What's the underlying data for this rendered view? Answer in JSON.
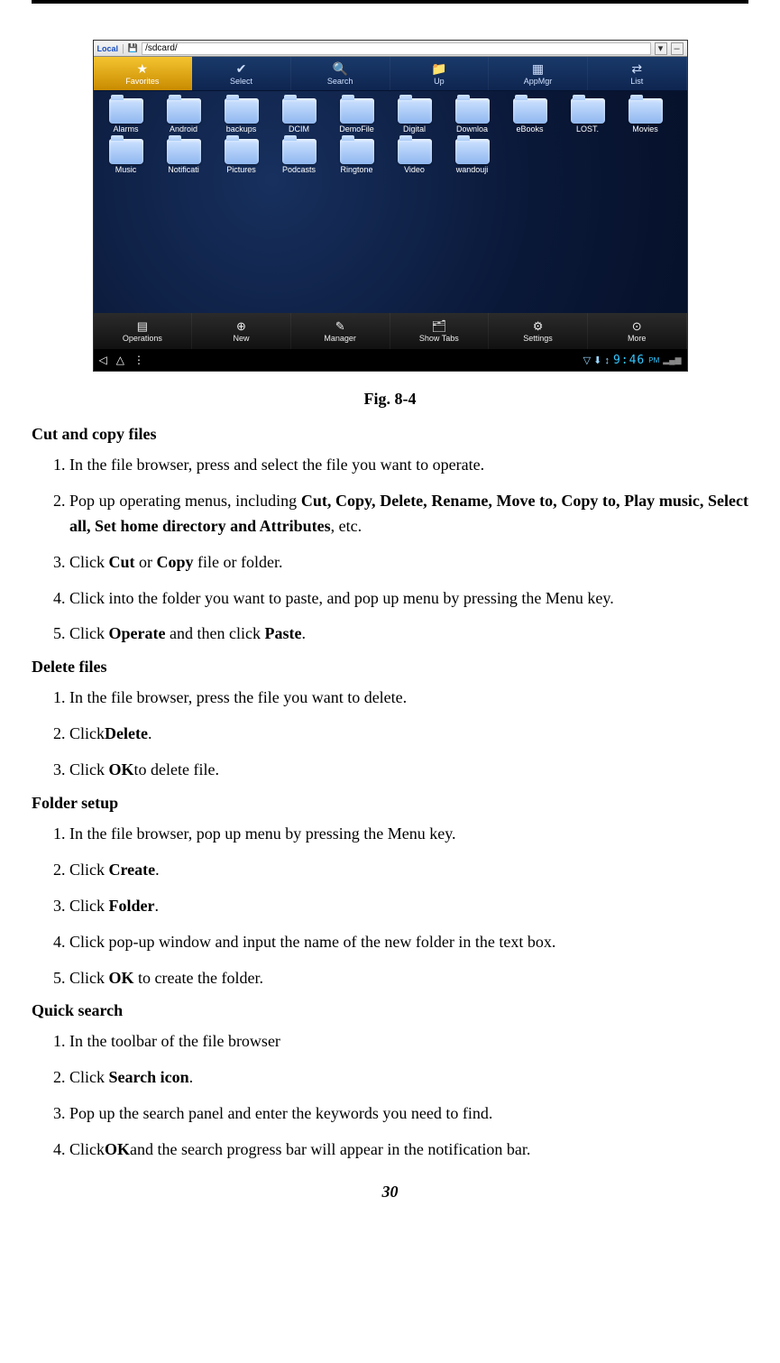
{
  "address_bar": {
    "local_label": "Local",
    "path": "/sdcard/"
  },
  "top_toolbar": [
    {
      "icon": "★",
      "label": "Favorites"
    },
    {
      "icon": "✔",
      "label": "Select"
    },
    {
      "icon": "🔍",
      "label": "Search"
    },
    {
      "icon": "📁",
      "label": "Up"
    },
    {
      "icon": "▦",
      "label": "AppMgr"
    },
    {
      "icon": "⇄",
      "label": "List"
    }
  ],
  "folders_row1": [
    "Alarms",
    "Android",
    "backups",
    "DCIM",
    "DemoFile",
    "Digital",
    "Downloa",
    "eBooks",
    "LOST.",
    "Movies"
  ],
  "folders_row2": [
    "Music",
    "Notificati",
    "Pictures",
    "Podcasts",
    "Ringtone",
    "Video",
    "wandouji"
  ],
  "bottom_toolbar": [
    {
      "icon": "▤",
      "label": "Operations"
    },
    {
      "icon": "⊕",
      "label": "New"
    },
    {
      "icon": "✎",
      "label": "Manager"
    },
    {
      "icon": "🗂",
      "label": "Show Tabs"
    },
    {
      "icon": "⚙",
      "label": "Settings"
    },
    {
      "icon": "⊙",
      "label": "More"
    }
  ],
  "sysbar": {
    "nav": [
      "◁",
      "△",
      "⋮"
    ],
    "status": [
      "▽",
      "⬇",
      "↕"
    ],
    "time": "9:46",
    "ampm": "PM",
    "signal": "▂▄▆"
  },
  "caption": "Fig. 8-4",
  "sections": {
    "cutcopy": {
      "title": "Cut and copy files",
      "items": [
        [
          {
            "t": "In the file browser, press and select the file you want to operate."
          }
        ],
        [
          {
            "t": "Pop up operating menus, including "
          },
          {
            "t": "Cut, Copy, Delete, Rename, Move to, Copy to, Play music, Select all, Set home directory and Attributes",
            "b": true
          },
          {
            "t": ", etc."
          }
        ],
        [
          {
            "t": "Click "
          },
          {
            "t": "Cut",
            "b": true
          },
          {
            "t": " or "
          },
          {
            "t": "Copy",
            "b": true
          },
          {
            "t": " file or folder."
          }
        ],
        [
          {
            "t": "Click into the folder you want to paste, and pop up menu by pressing the Menu key."
          }
        ],
        [
          {
            "t": "Click "
          },
          {
            "t": "Operate",
            "b": true
          },
          {
            "t": " and then click "
          },
          {
            "t": "Paste",
            "b": true
          },
          {
            "t": "."
          }
        ]
      ]
    },
    "delete": {
      "title": "Delete files",
      "items": [
        [
          {
            "t": "In the file browser, press the file you want to delete."
          }
        ],
        [
          {
            "t": "Click"
          },
          {
            "t": "Delete",
            "b": true
          },
          {
            "t": "."
          }
        ],
        [
          {
            "t": "Click "
          },
          {
            "t": "OK",
            "b": true
          },
          {
            "t": "to delete file."
          }
        ]
      ]
    },
    "foldersetup": {
      "title": "Folder setup",
      "items": [
        [
          {
            "t": "In the file browser, pop up menu by pressing the Menu key."
          }
        ],
        [
          {
            "t": "Click "
          },
          {
            "t": "Create",
            "b": true
          },
          {
            "t": "."
          }
        ],
        [
          {
            "t": "Click "
          },
          {
            "t": "Folder",
            "b": true
          },
          {
            "t": "."
          }
        ],
        [
          {
            "t": "Click pop-up window and input the name of the new folder in the text box."
          }
        ],
        [
          {
            "t": "Click "
          },
          {
            "t": "OK",
            "b": true
          },
          {
            "t": " to create the folder."
          }
        ]
      ]
    },
    "quicksearch": {
      "title": "Quick search",
      "items": [
        [
          {
            "t": "In the toolbar of the file browser"
          }
        ],
        [
          {
            "t": "Click "
          },
          {
            "t": "Search icon",
            "b": true
          },
          {
            "t": "."
          }
        ],
        [
          {
            "t": "Pop up the search panel and enter the keywords you need to find."
          }
        ],
        [
          {
            "t": "Click"
          },
          {
            "t": "OK",
            "b": true
          },
          {
            "t": "and the search progress bar will appear in the notification bar."
          }
        ]
      ]
    }
  },
  "page_number": "30"
}
